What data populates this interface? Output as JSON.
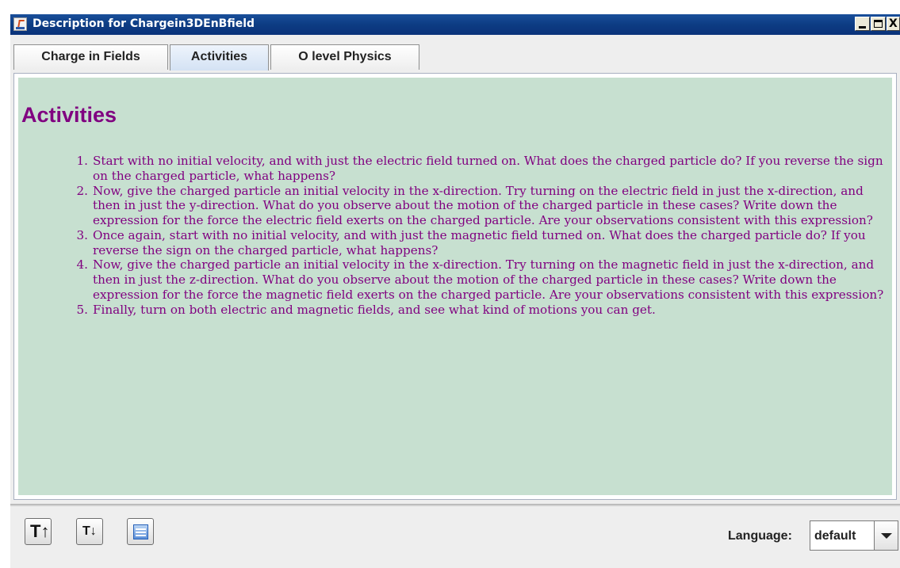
{
  "window": {
    "title": "Description for Chargein3DEnBfield",
    "close_glyph": "X"
  },
  "tabs": [
    {
      "label": "Charge in Fields",
      "selected": false
    },
    {
      "label": "Activities",
      "selected": true
    },
    {
      "label": "O level Physics",
      "selected": false
    }
  ],
  "content": {
    "background_color": "#c7e0d0",
    "text_color": "#800080",
    "heading": "Activities",
    "items": [
      {
        "num": "1.",
        "text": "Start with no initial velocity, and with just the electric field turned on. What does the charged particle do? If you reverse the sign on the charged particle, what happens?"
      },
      {
        "num": "2.",
        "text": "Now, give the charged particle an initial velocity in the x-direction. Try turning on the electric field in just the x-direction, and then in just the y-direction. What do you observe about the motion of the charged particle in these cases? Write down the expression for the force the electric field exerts on the charged particle. Are your observations consistent with this expression?"
      },
      {
        "num": "3.",
        "text": "Once again, start with no initial velocity, and with just the magnetic field turned on. What does the charged particle do? If you reverse the sign on the charged particle, what happens?"
      },
      {
        "num": "4.",
        "text": "Now, give the charged particle an initial velocity in the x-direction. Try turning on the magnetic field in just the x-direction, and then in just the z-direction. What do you observe about the motion of the charged particle in these cases? Write down the expression for the force the magnetic field exerts on the charged particle. Are your observations consistent with this expression?"
      },
      {
        "num": "5.",
        "text": "Finally, turn on both electric and magnetic fields, and see what kind of motions you can get."
      }
    ]
  },
  "toolbar": {
    "font_up_glyph": "T↑",
    "font_down_glyph": "T↓",
    "language_label": "Language:",
    "language_value": "default"
  }
}
